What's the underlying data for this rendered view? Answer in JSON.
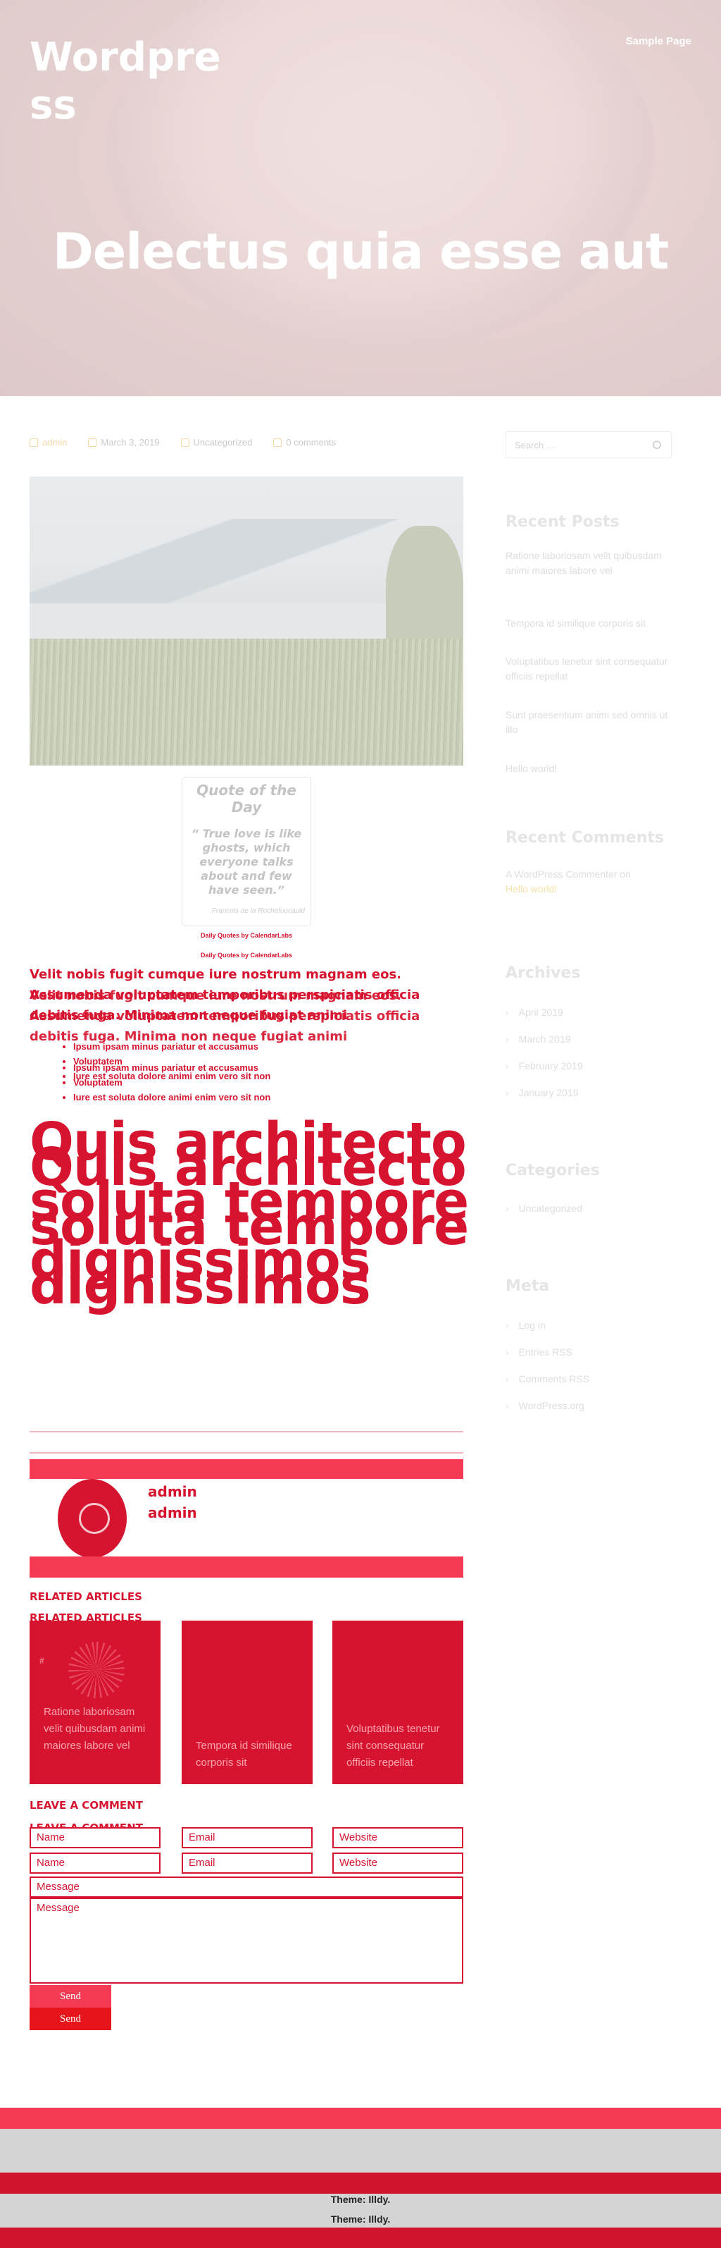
{
  "site": {
    "title": "Wordpress",
    "nav": [
      "Sample Page"
    ]
  },
  "hero": {
    "title": "Delectus quia esse aut"
  },
  "meta": {
    "author": "admin",
    "date": "March 3, 2019",
    "category": "Uncategorized",
    "comments": "0 comments"
  },
  "quote": {
    "title": "Quote of the Day",
    "text": "“ True love is like ghosts, which everyone talks about and few have seen.”",
    "author": "Francois de la Rochefoucauld",
    "credit": "Daily Quotes by CalendarLabs"
  },
  "content": {
    "paragraph": "Velit nobis fugit cumque iure nostrum magnam eos. Assumenda voluptatem temporibus perspiciatis officia debitis fuga. Minima non neque fugiat animi",
    "list": [
      "Ipsum ipsam minus pariatur et accusamus",
      "Voluptatem",
      "Iure est soluta dolore animi enim vero sit non"
    ],
    "heading": "Quis architecto soluta tempore dignissimos"
  },
  "author_box": {
    "name": "admin"
  },
  "related": {
    "heading": "RELATED ARTICLES",
    "items": [
      {
        "hash": "#",
        "title": "Ratione laboriosam velit quibusdam animi maiores labore vel"
      },
      {
        "title": "Tempora id similique corporis sit"
      },
      {
        "title": "Voluptatibus tenetur sint consequatur officiis repellat"
      }
    ]
  },
  "comment_form": {
    "heading": "LEAVE A COMMENT",
    "name": "Name",
    "email": "Email",
    "website": "Website",
    "message": "Message",
    "send": "Send"
  },
  "sidebar": {
    "search_placeholder": "Search …",
    "recent_posts_title": "Recent Posts",
    "recent_posts": [
      "Ratione laboriosam velit quibusdam animi maiores labore vel",
      "Tempora id similique corporis sit",
      "Voluptatibus tenetur sint consequatur officiis repellat",
      "Sunt praesentium animi sed omnis ut illo",
      "Hello world!"
    ],
    "recent_comments_title": "Recent Comments",
    "comment_author": "A WordPress Commenter",
    "comment_on": "on",
    "comment_post": "Hello world!",
    "archives_title": "Archives",
    "archives": [
      "April 2019",
      "March 2019",
      "February 2019",
      "January 2019"
    ],
    "categories_title": "Categories",
    "categories": [
      "Uncategorized"
    ],
    "meta_title": "Meta",
    "meta_links": [
      "Log in",
      "Entries RSS",
      "Comments RSS",
      "WordPress.org"
    ]
  },
  "footer": {
    "theme": "Theme: Illdy."
  },
  "colors": {
    "accent": "#d7142f",
    "accent_light": "#f53b53",
    "footer_gray": "#d4d4d4"
  }
}
